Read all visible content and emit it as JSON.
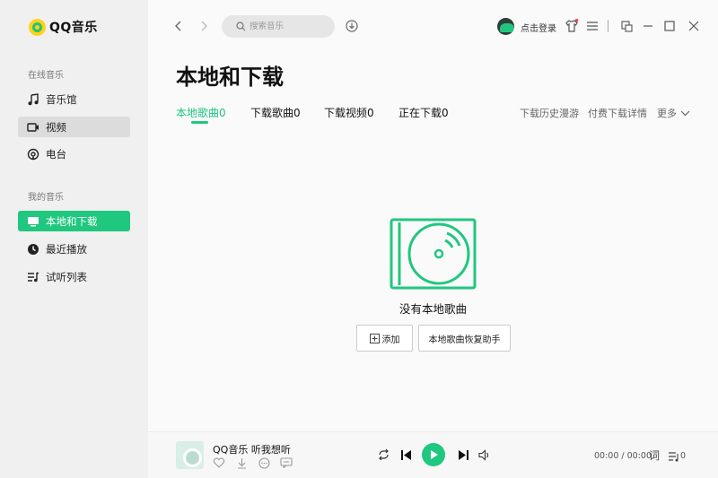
{
  "app": {
    "name": "QQ音乐"
  },
  "sidebar": {
    "online_title": "在线音乐",
    "online_items": [
      {
        "label": "音乐馆",
        "icon": "music-note-icon"
      },
      {
        "label": "视频",
        "icon": "video-icon"
      },
      {
        "label": "电台",
        "icon": "radio-icon"
      }
    ],
    "my_title": "我的音乐",
    "my_items": [
      {
        "label": "本地和下载",
        "icon": "monitor-icon",
        "active": true
      },
      {
        "label": "最近播放",
        "icon": "clock-icon"
      },
      {
        "label": "试听列表",
        "icon": "playlist-icon"
      }
    ]
  },
  "topbar": {
    "search_placeholder": "搜索音乐",
    "login_label": "点击登录"
  },
  "main": {
    "title": "本地和下载",
    "tabs": [
      {
        "label": "本地歌曲0",
        "active": true
      },
      {
        "label": "下载歌曲0"
      },
      {
        "label": "下载视频0"
      },
      {
        "label": "正在下载0"
      }
    ],
    "right_links": [
      "下载历史漫游",
      "付费下载详情",
      "更多"
    ],
    "empty_text": "没有本地歌曲",
    "add_button": "添加",
    "restore_button": "本地歌曲恢复助手"
  },
  "player": {
    "song": "QQ音乐 听我想听",
    "time": "00:00 / 00:00",
    "lyrics_label": "词",
    "playlist_count": "0"
  },
  "colors": {
    "accent": "#20c77f",
    "sidebar_bg": "#f0f0f0",
    "logo_yellow": "#ffd21a"
  }
}
